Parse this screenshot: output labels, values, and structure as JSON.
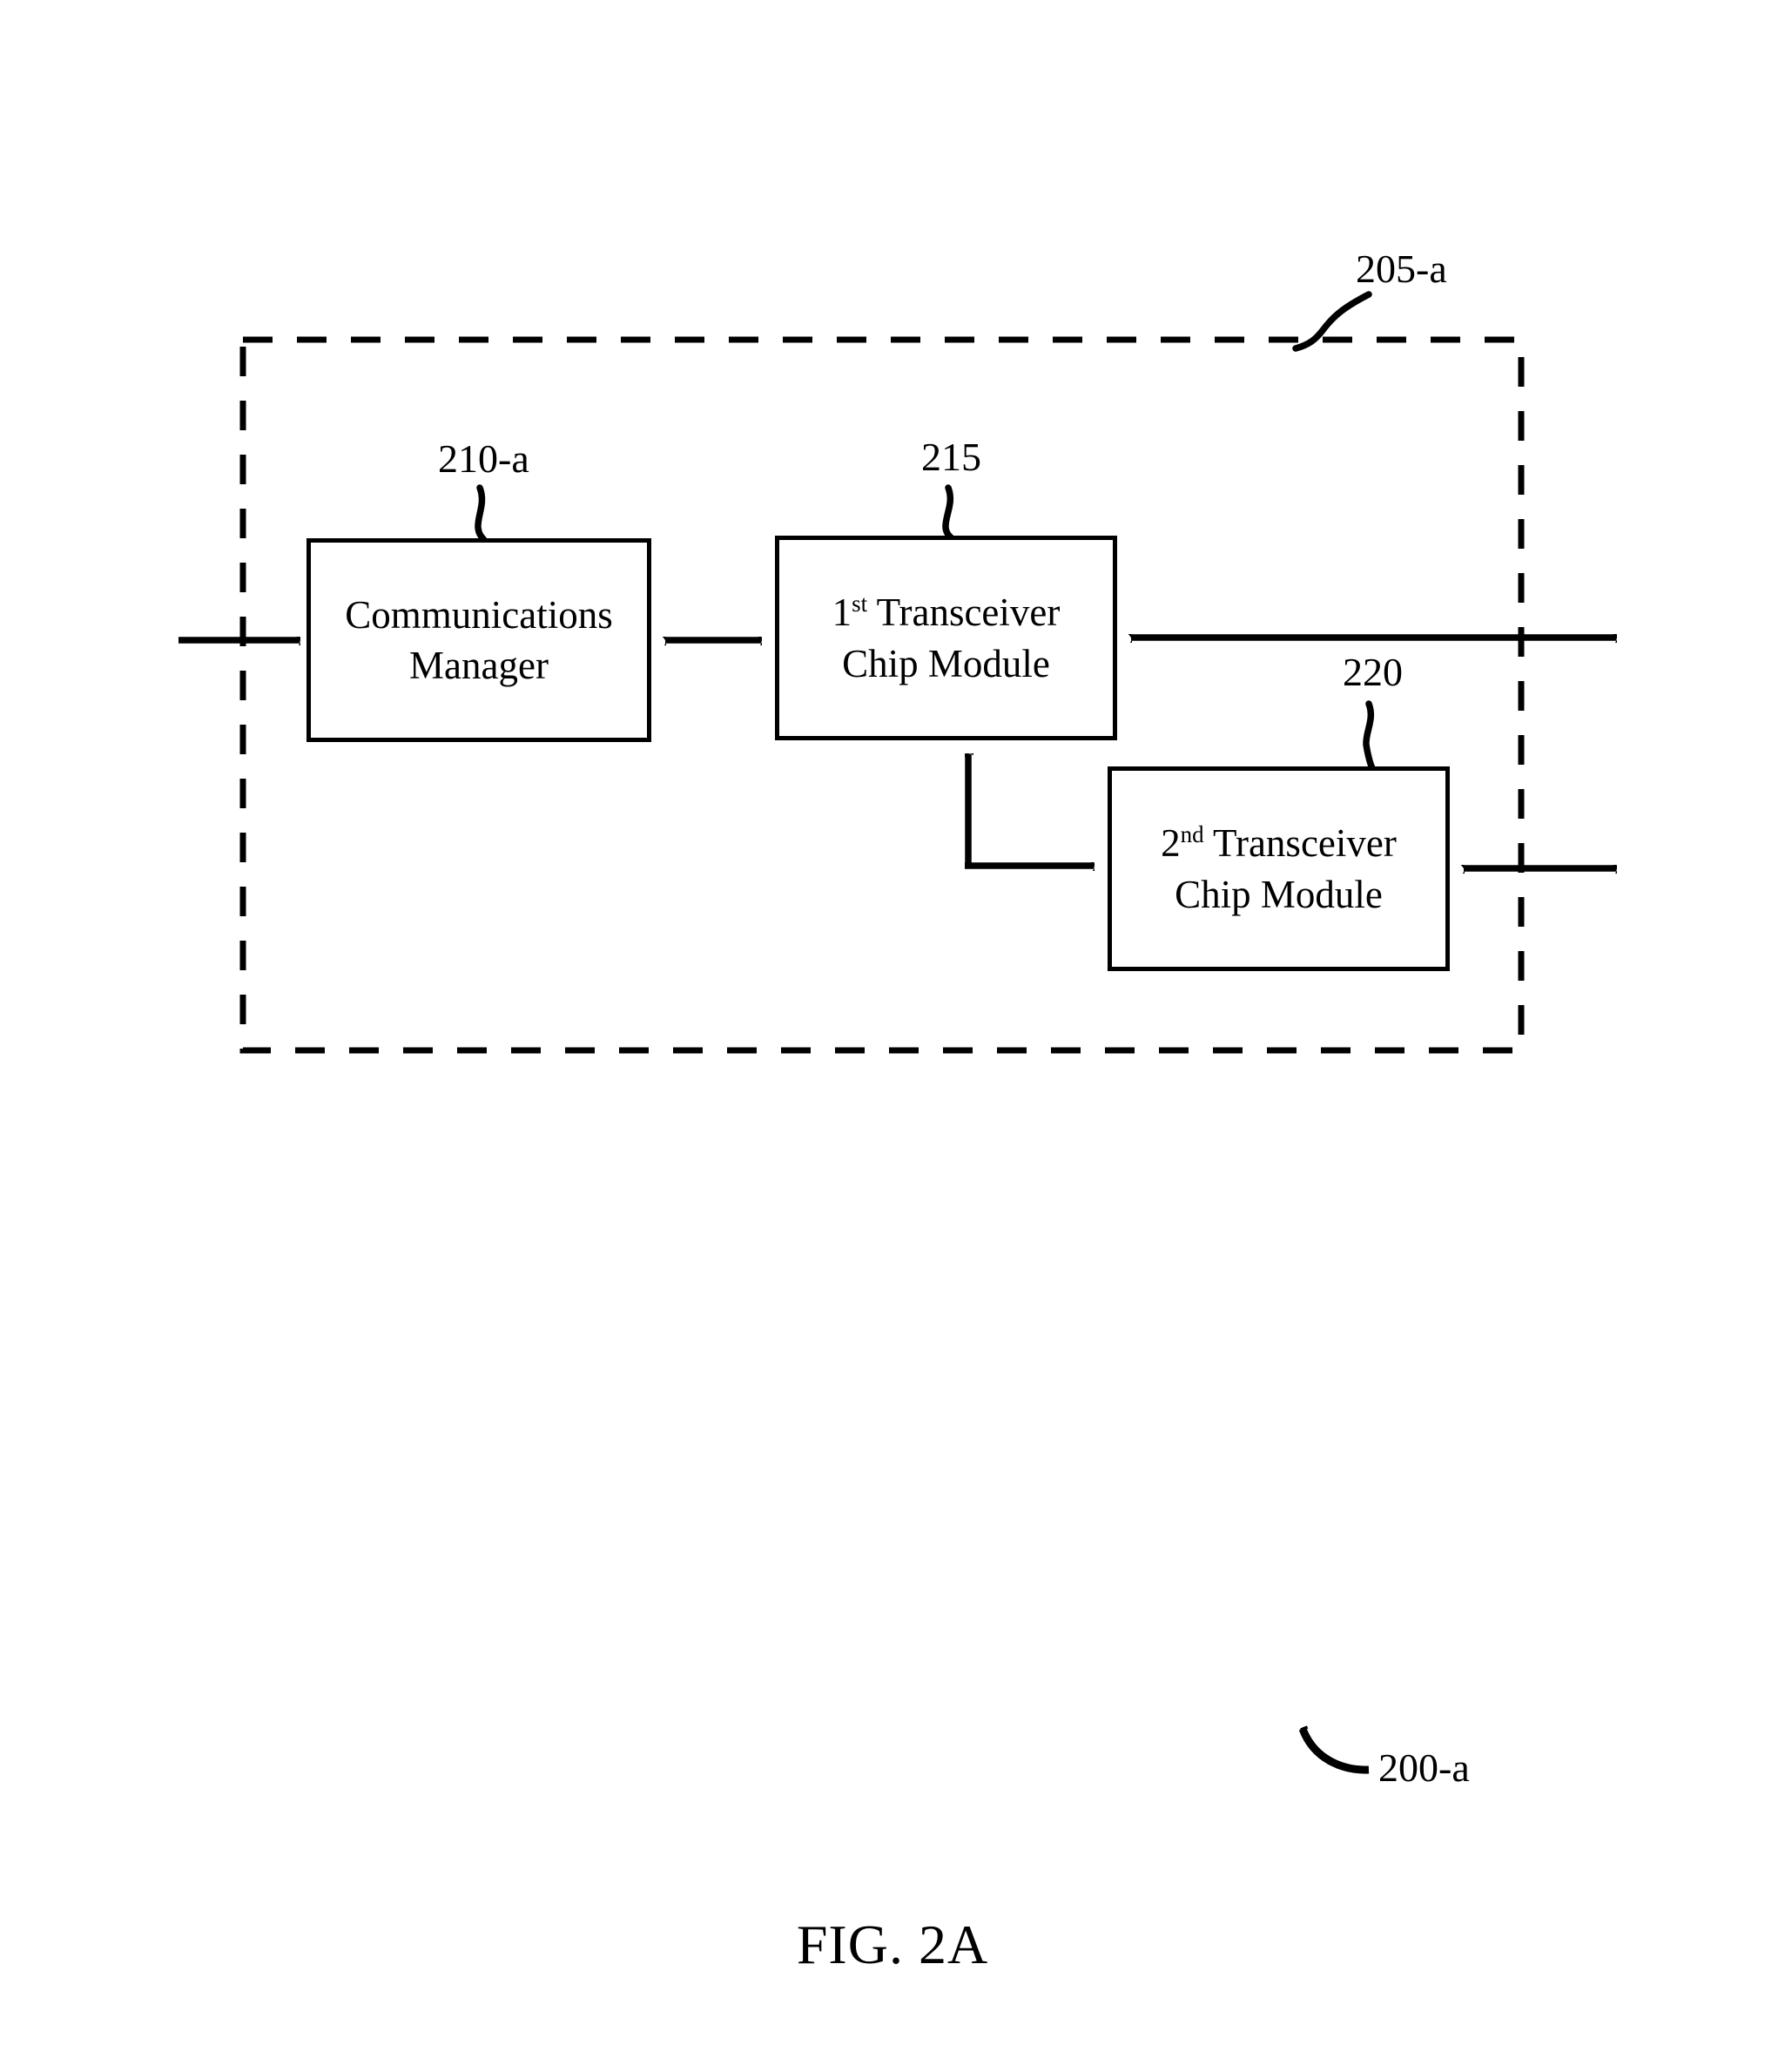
{
  "figure": {
    "caption": "FIG. 2A",
    "overall_ref": "200-a",
    "boundary_ref": "205-a"
  },
  "blocks": [
    {
      "id": "communications-manager",
      "ref": "210-a",
      "line1": "Communications",
      "line2": "Manager",
      "ordinal": "",
      "ordinal_sup": ""
    },
    {
      "id": "first-transceiver-chip-module",
      "ref": "215",
      "ordinal": "1",
      "ordinal_sup": "st",
      "line1": " Transceiver",
      "line2": "Chip Module"
    },
    {
      "id": "second-transceiver-chip-module",
      "ref": "220",
      "ordinal": "2",
      "ordinal_sup": "nd",
      "line1": " Transceiver",
      "line2": "Chip Module"
    }
  ],
  "connectors": [
    {
      "name": "external-input-to-communications-manager",
      "direction": "right"
    },
    {
      "name": "communications-manager-to-first-transceiver",
      "direction": "bidirectional"
    },
    {
      "name": "first-transceiver-to-external",
      "direction": "bidirectional"
    },
    {
      "name": "first-transceiver-to-second-transceiver",
      "direction": "elbow-bidirectional"
    },
    {
      "name": "second-transceiver-to-external",
      "direction": "bidirectional"
    }
  ],
  "style": {
    "stroke": "#000000",
    "background": "#ffffff"
  }
}
